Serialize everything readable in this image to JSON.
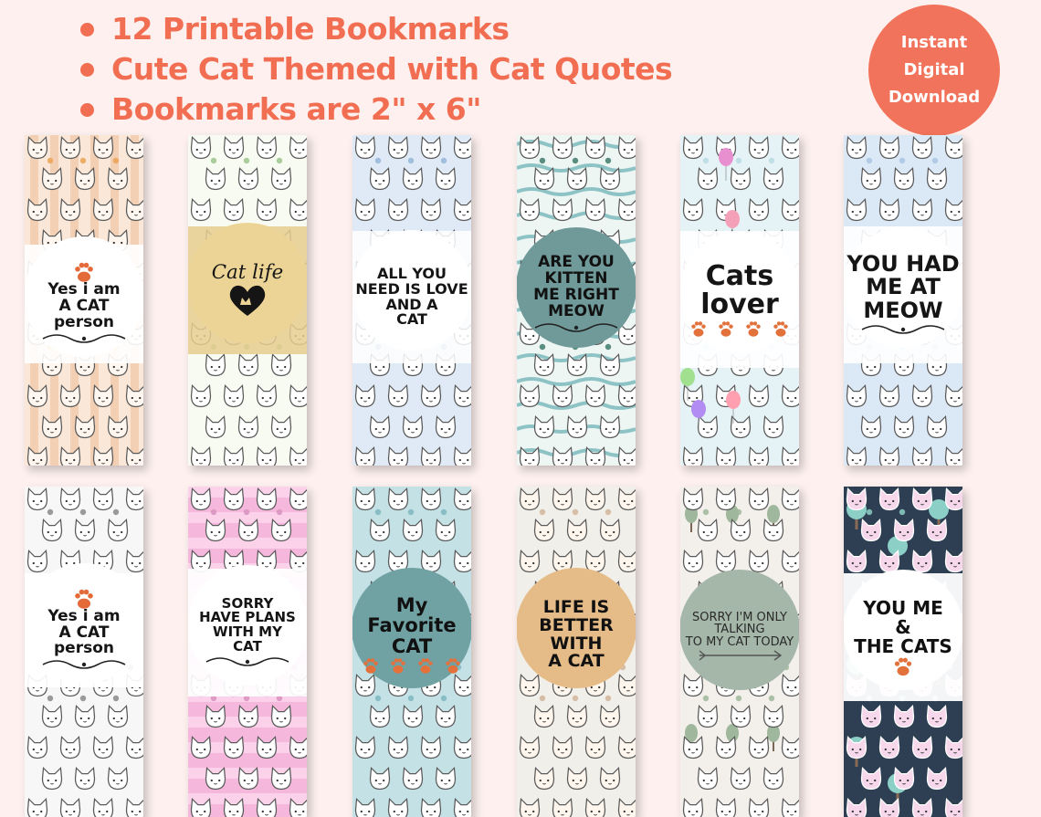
{
  "header": {
    "features": [
      "12 Printable Bookmarks",
      "Cute Cat Themed with Cat Quotes",
      "Bookmarks are 2\" x 6\""
    ]
  },
  "badge": {
    "line1": "Instant",
    "line2": "Digital",
    "line3": "Download"
  },
  "colors": {
    "accent": "#f26e52",
    "background": "#fdf0ee"
  },
  "bookmarks": [
    {
      "quote": "Yes i am\nA CAT\nperson",
      "pattern": "autumn-stripes"
    },
    {
      "quote": "Cat life",
      "pattern": "flowers-cats"
    },
    {
      "quote": "ALL YOU\nNEED IS LOVE\nAND A\nCAT",
      "pattern": "blue-cats-fish"
    },
    {
      "quote": "ARE YOU KITTEN\nME RIGHT\nMEOW",
      "pattern": "sea-waves-cats"
    },
    {
      "quote": "Cats\nlover",
      "pattern": "balloons-cats"
    },
    {
      "quote": "YOU HAD\nME AT\nMEOW",
      "pattern": "clouds-kites-cats"
    },
    {
      "quote": "Yes i am\nA CAT\nperson",
      "pattern": "grey-white-cats"
    },
    {
      "quote": "SORRY\nHAVE PLANS\nWITH MY\nCAT",
      "pattern": "pink-stripes-cats"
    },
    {
      "quote": "My\nFavorite\nCAT",
      "pattern": "teal-swirls-cats"
    },
    {
      "quote": "LIFE IS\nBETTER WITH\nA CAT",
      "pattern": "crowd-cats"
    },
    {
      "quote": "SORRY I'M ONLY\nTALKING\nTO MY CAT TODAY",
      "pattern": "trees-cats"
    },
    {
      "quote": "YOU ME\n&\nTHE CATS",
      "pattern": "navy-trees-cats"
    }
  ]
}
